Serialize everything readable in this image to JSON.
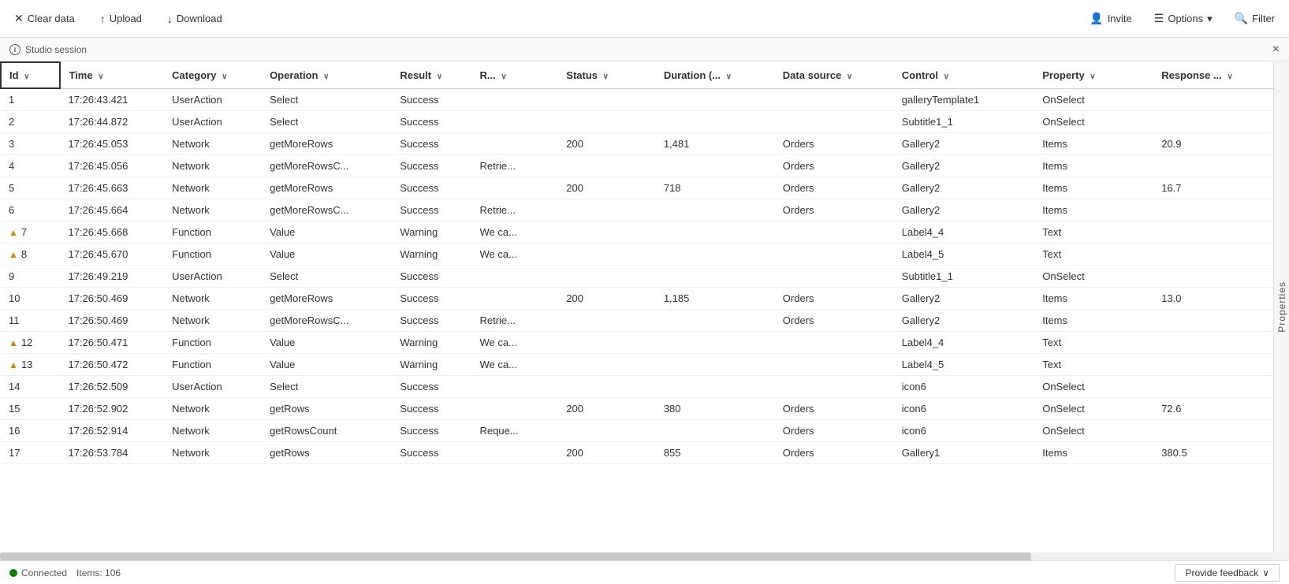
{
  "toolbar": {
    "clear_data_label": "Clear data",
    "upload_label": "Upload",
    "download_label": "Download",
    "invite_label": "Invite",
    "options_label": "Options",
    "filter_label": "Filter"
  },
  "session": {
    "label": "Studio session",
    "close_label": "×"
  },
  "columns": [
    {
      "id": "id",
      "label": "Id",
      "sortable": true
    },
    {
      "id": "time",
      "label": "Time",
      "sortable": true
    },
    {
      "id": "category",
      "label": "Category",
      "sortable": true
    },
    {
      "id": "operation",
      "label": "Operation",
      "sortable": true
    },
    {
      "id": "result",
      "label": "Result",
      "sortable": true
    },
    {
      "id": "r",
      "label": "R...",
      "sortable": true
    },
    {
      "id": "status",
      "label": "Status",
      "sortable": true
    },
    {
      "id": "duration",
      "label": "Duration (...",
      "sortable": true
    },
    {
      "id": "datasource",
      "label": "Data source",
      "sortable": true
    },
    {
      "id": "control",
      "label": "Control",
      "sortable": true
    },
    {
      "id": "property",
      "label": "Property",
      "sortable": true
    },
    {
      "id": "response",
      "label": "Response ...",
      "sortable": true
    }
  ],
  "rows": [
    {
      "id": 1,
      "warning": false,
      "time": "17:26:43.421",
      "category": "UserAction",
      "operation": "Select",
      "result": "Success",
      "r": "",
      "status": "",
      "duration": "",
      "datasource": "",
      "control": "galleryTemplate1",
      "property": "OnSelect",
      "response": ""
    },
    {
      "id": 2,
      "warning": false,
      "time": "17:26:44.872",
      "category": "UserAction",
      "operation": "Select",
      "result": "Success",
      "r": "",
      "status": "",
      "duration": "",
      "datasource": "",
      "control": "Subtitle1_1",
      "property": "OnSelect",
      "response": ""
    },
    {
      "id": 3,
      "warning": false,
      "time": "17:26:45.053",
      "category": "Network",
      "operation": "getMoreRows",
      "result": "Success",
      "r": "",
      "status": "200",
      "duration": "1,481",
      "datasource": "Orders",
      "control": "Gallery2",
      "property": "Items",
      "response": "20.9"
    },
    {
      "id": 4,
      "warning": false,
      "time": "17:26:45.056",
      "category": "Network",
      "operation": "getMoreRowsC...",
      "result": "Success",
      "r": "Retrie...",
      "status": "",
      "duration": "",
      "datasource": "Orders",
      "control": "Gallery2",
      "property": "Items",
      "response": ""
    },
    {
      "id": 5,
      "warning": false,
      "time": "17:26:45.663",
      "category": "Network",
      "operation": "getMoreRows",
      "result": "Success",
      "r": "",
      "status": "200",
      "duration": "718",
      "datasource": "Orders",
      "control": "Gallery2",
      "property": "Items",
      "response": "16.7"
    },
    {
      "id": 6,
      "warning": false,
      "time": "17:26:45.664",
      "category": "Network",
      "operation": "getMoreRowsC...",
      "result": "Success",
      "r": "Retrie...",
      "status": "",
      "duration": "",
      "datasource": "Orders",
      "control": "Gallery2",
      "property": "Items",
      "response": ""
    },
    {
      "id": 7,
      "warning": true,
      "time": "17:26:45.668",
      "category": "Function",
      "operation": "Value",
      "result": "Warning",
      "r": "We ca...",
      "status": "",
      "duration": "",
      "datasource": "",
      "control": "Label4_4",
      "property": "Text",
      "response": ""
    },
    {
      "id": 8,
      "warning": true,
      "time": "17:26:45.670",
      "category": "Function",
      "operation": "Value",
      "result": "Warning",
      "r": "We ca...",
      "status": "",
      "duration": "",
      "datasource": "",
      "control": "Label4_5",
      "property": "Text",
      "response": ""
    },
    {
      "id": 9,
      "warning": false,
      "time": "17:26:49.219",
      "category": "UserAction",
      "operation": "Select",
      "result": "Success",
      "r": "",
      "status": "",
      "duration": "",
      "datasource": "",
      "control": "Subtitle1_1",
      "property": "OnSelect",
      "response": ""
    },
    {
      "id": 10,
      "warning": false,
      "time": "17:26:50.469",
      "category": "Network",
      "operation": "getMoreRows",
      "result": "Success",
      "r": "",
      "status": "200",
      "duration": "1,185",
      "datasource": "Orders",
      "control": "Gallery2",
      "property": "Items",
      "response": "13.0"
    },
    {
      "id": 11,
      "warning": false,
      "time": "17:26:50.469",
      "category": "Network",
      "operation": "getMoreRowsC...",
      "result": "Success",
      "r": "Retrie...",
      "status": "",
      "duration": "",
      "datasource": "Orders",
      "control": "Gallery2",
      "property": "Items",
      "response": ""
    },
    {
      "id": 12,
      "warning": true,
      "time": "17:26:50.471",
      "category": "Function",
      "operation": "Value",
      "result": "Warning",
      "r": "We ca...",
      "status": "",
      "duration": "",
      "datasource": "",
      "control": "Label4_4",
      "property": "Text",
      "response": ""
    },
    {
      "id": 13,
      "warning": true,
      "time": "17:26:50.472",
      "category": "Function",
      "operation": "Value",
      "result": "Warning",
      "r": "We ca...",
      "status": "",
      "duration": "",
      "datasource": "",
      "control": "Label4_5",
      "property": "Text",
      "response": ""
    },
    {
      "id": 14,
      "warning": false,
      "time": "17:26:52.509",
      "category": "UserAction",
      "operation": "Select",
      "result": "Success",
      "r": "",
      "status": "",
      "duration": "",
      "datasource": "",
      "control": "icon6",
      "property": "OnSelect",
      "response": ""
    },
    {
      "id": 15,
      "warning": false,
      "time": "17:26:52.902",
      "category": "Network",
      "operation": "getRows",
      "result": "Success",
      "r": "",
      "status": "200",
      "duration": "380",
      "datasource": "Orders",
      "control": "icon6",
      "property": "OnSelect",
      "response": "72.6"
    },
    {
      "id": 16,
      "warning": false,
      "time": "17:26:52.914",
      "category": "Network",
      "operation": "getRowsCount",
      "result": "Success",
      "r": "Reque...",
      "status": "",
      "duration": "",
      "datasource": "Orders",
      "control": "icon6",
      "property": "OnSelect",
      "response": ""
    },
    {
      "id": 17,
      "warning": false,
      "time": "17:26:53.784",
      "category": "Network",
      "operation": "getRows",
      "result": "Success",
      "r": "",
      "status": "200",
      "duration": "855",
      "datasource": "Orders",
      "control": "Gallery1",
      "property": "Items",
      "response": "380.5"
    }
  ],
  "status": {
    "connected_label": "Connected",
    "items_label": "Items: 106",
    "provide_feedback_label": "Provide feedback"
  },
  "right_panel": {
    "label": "Properties"
  }
}
